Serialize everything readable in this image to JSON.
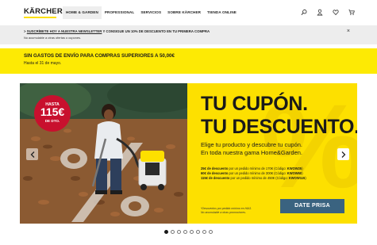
{
  "header": {
    "logo_text": "KÄRCHER",
    "nav": [
      "HOME & GARDEN",
      "PROFESSIONAL",
      "SERVICIOS",
      "SOBRE KÄRCHER",
      "TIENDA ONLINE"
    ],
    "icons": [
      "search-icon",
      "user-icon",
      "heart-icon",
      "cart-icon"
    ]
  },
  "newsletter": {
    "prefix": "> ",
    "link": "SUSCRÍBETE HOY A NUESTRA NEWSLETTER",
    "rest": " Y CONSIGUE UN 10% DE DESCUENTO EN TU PRIMERA COMPRA",
    "note": "No acumulable a otras ofertas o cupones.",
    "close": "×"
  },
  "shipping": {
    "title": "SIN GASTOS DE ENVÍO PARA COMPRAS SUPERIORES A 50,00€",
    "subtitle": "Hasta el 31 de mayo."
  },
  "hero": {
    "badge": {
      "top": "HASTA",
      "amount": "115€",
      "bottom": "DE DTO."
    },
    "title_line1": "TU CUPÓN.",
    "title_line2": "TU DESCUENTO.",
    "subtitle_line1": "Elige tu producto y descubre tu cupón.",
    "subtitle_line2": "En toda nuestra gama Home&Garden.",
    "offers": [
      {
        "amount": "25€ de descuento",
        "text": " por un pedido mínimo de 170€ (Código: ",
        "code": "KWOW25",
        "end": ")"
      },
      {
        "amount": "60€ de descuento",
        "text": " por un pedido mínimo de 300€ (Código: ",
        "code": "KWOW60",
        "end": ")"
      },
      {
        "amount": "115€ de descuento",
        "text": " por un pedido mínimo de 450€ (Código: ",
        "code": "KWOW115",
        "end": ")"
      }
    ],
    "footnote_line1": "*Descuentos por pedido mínimo en H&G.",
    "footnote_line2": "No acumulable a otras promociones.",
    "cta": "DATE PRISA",
    "watermark": "%",
    "active_slide": 1,
    "slide_count": 8
  },
  "colors": {
    "brand_yellow": "#fde000",
    "badge_red": "#c8102e",
    "cta_blue": "#3a6380"
  }
}
